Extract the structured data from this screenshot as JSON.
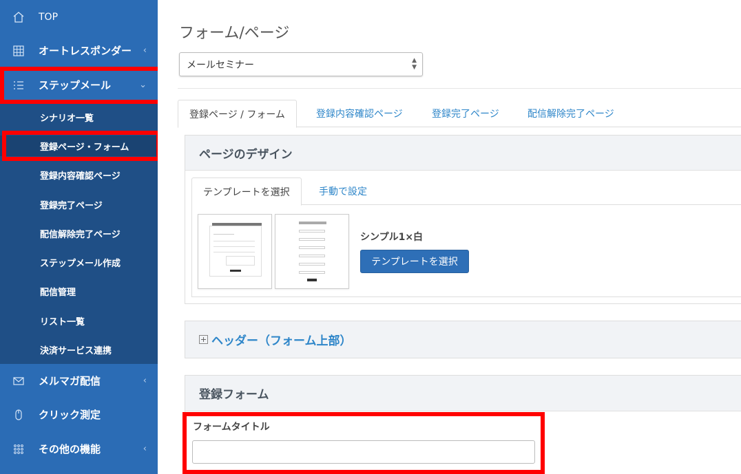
{
  "sidebar": {
    "top": {
      "label": "TOP",
      "icon": "home-icon"
    },
    "autoresponder": {
      "label": "オートレスポンダー",
      "icon": "grid-icon"
    },
    "stepmail": {
      "label": "ステップメール",
      "icon": "list-icon"
    },
    "submenu": [
      {
        "label": "シナリオ一覧"
      },
      {
        "label": "登録ページ・フォーム"
      },
      {
        "label": "登録内容確認ページ"
      },
      {
        "label": "登録完了ページ"
      },
      {
        "label": "配信解除完了ページ"
      },
      {
        "label": "ステップメール作成"
      },
      {
        "label": "配信管理"
      },
      {
        "label": "リスト一覧"
      },
      {
        "label": "決済サービス連携"
      }
    ],
    "magazine": {
      "label": "メルマガ配信",
      "icon": "mail-icon"
    },
    "click": {
      "label": "クリック測定",
      "icon": "mouse-icon"
    },
    "other": {
      "label": "その他の機能",
      "icon": "apps-icon"
    },
    "chevron_left": "‹",
    "chevron_down": "⌄"
  },
  "main": {
    "title": "フォーム/ページ",
    "select_value": "メールセミナー",
    "tabs": [
      {
        "label": "登録ページ / フォーム"
      },
      {
        "label": "登録内容確認ページ"
      },
      {
        "label": "登録完了ページ"
      },
      {
        "label": "配信解除完了ページ"
      }
    ],
    "design_panel": {
      "title": "ページのデザイン",
      "inner_tabs": [
        {
          "label": "テンプレートを選択"
        },
        {
          "label": "手動で設定"
        }
      ],
      "template_name": "シンプル1×白",
      "select_button": "テンプレートを選択"
    },
    "header_panel": {
      "title": "ヘッダー（フォーム上部）"
    },
    "form_panel": {
      "title": "登録フォーム",
      "field_label": "フォームタイトル",
      "field_value": ""
    }
  },
  "colors": {
    "sidebar": "#2b6cb5",
    "submenu": "#1f4f86",
    "highlight": "#ff0000",
    "link": "#2e86c9",
    "primary_button": "#2e6fb7"
  }
}
